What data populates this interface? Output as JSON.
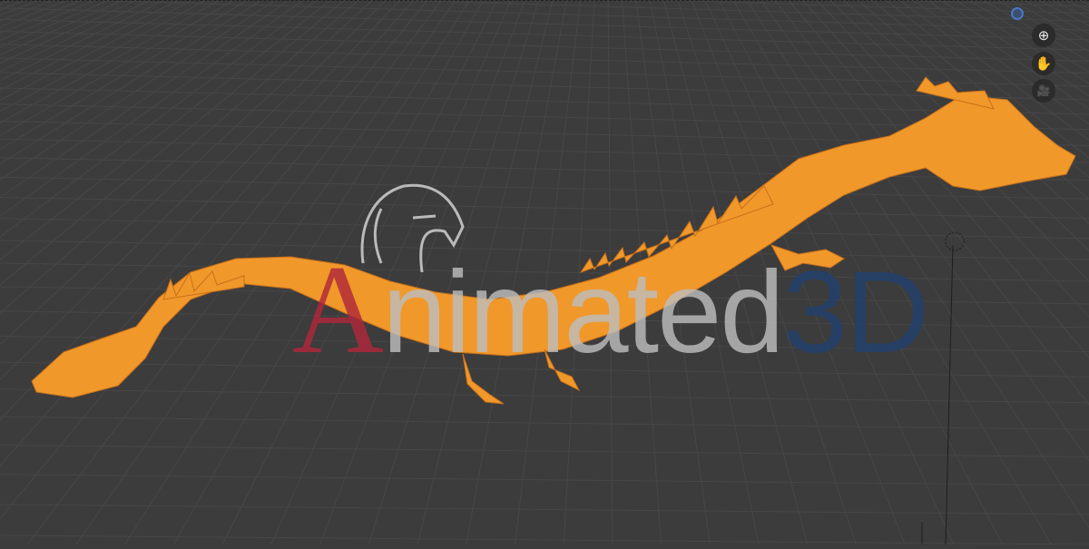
{
  "viewport": {
    "background": "#3c3c3c",
    "object_color": "#f09a28"
  },
  "navigation": {
    "axis_indicator": "view-axis-dot",
    "buttons": [
      {
        "name": "zoom",
        "icon": "zoom-in-icon",
        "glyph": "⊕"
      },
      {
        "name": "pan",
        "icon": "hand-icon",
        "glyph": "✋"
      },
      {
        "name": "camera",
        "icon": "camera-icon",
        "glyph": "🎥"
      }
    ]
  },
  "watermark": {
    "part1": "A",
    "part2": "nimated",
    "part3": "3D"
  }
}
